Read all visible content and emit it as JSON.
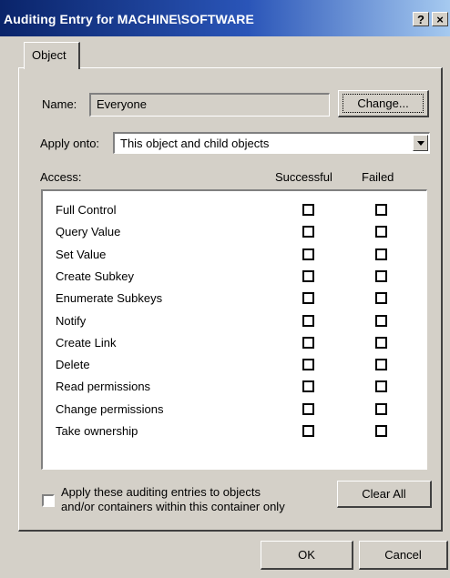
{
  "window": {
    "title": "Auditing Entry for MACHINE\\SOFTWARE"
  },
  "titlebar": {
    "help_label": "?",
    "close_label": "×"
  },
  "tabs": [
    {
      "label": "Object"
    }
  ],
  "name_row": {
    "label": "Name:",
    "value": "Everyone",
    "change_button": "Change..."
  },
  "apply_row": {
    "label": "Apply onto:",
    "value": "This object and child objects"
  },
  "access": {
    "label": "Access:",
    "col_successful": "Successful",
    "col_failed": "Failed",
    "items": [
      {
        "label": "Full Control",
        "successful": false,
        "failed": false
      },
      {
        "label": "Query Value",
        "successful": false,
        "failed": false
      },
      {
        "label": "Set Value",
        "successful": false,
        "failed": false
      },
      {
        "label": "Create Subkey",
        "successful": false,
        "failed": false
      },
      {
        "label": "Enumerate Subkeys",
        "successful": false,
        "failed": false
      },
      {
        "label": "Notify",
        "successful": false,
        "failed": false
      },
      {
        "label": "Create Link",
        "successful": false,
        "failed": false
      },
      {
        "label": "Delete",
        "successful": false,
        "failed": false
      },
      {
        "label": "Read permissions",
        "successful": false,
        "failed": false
      },
      {
        "label": "Change permissions",
        "successful": false,
        "failed": false
      },
      {
        "label": "Take ownership",
        "successful": false,
        "failed": false
      }
    ]
  },
  "apply_checkbox": {
    "line1": "Apply these auditing entries to objects",
    "line2": "and/or containers within this container only",
    "checked": false
  },
  "buttons": {
    "clear_all": "Clear All",
    "ok": "OK",
    "cancel": "Cancel"
  },
  "colors": {
    "face": "#d4d0c8",
    "title_start": "#0a246a",
    "title_end": "#a6caf0"
  }
}
